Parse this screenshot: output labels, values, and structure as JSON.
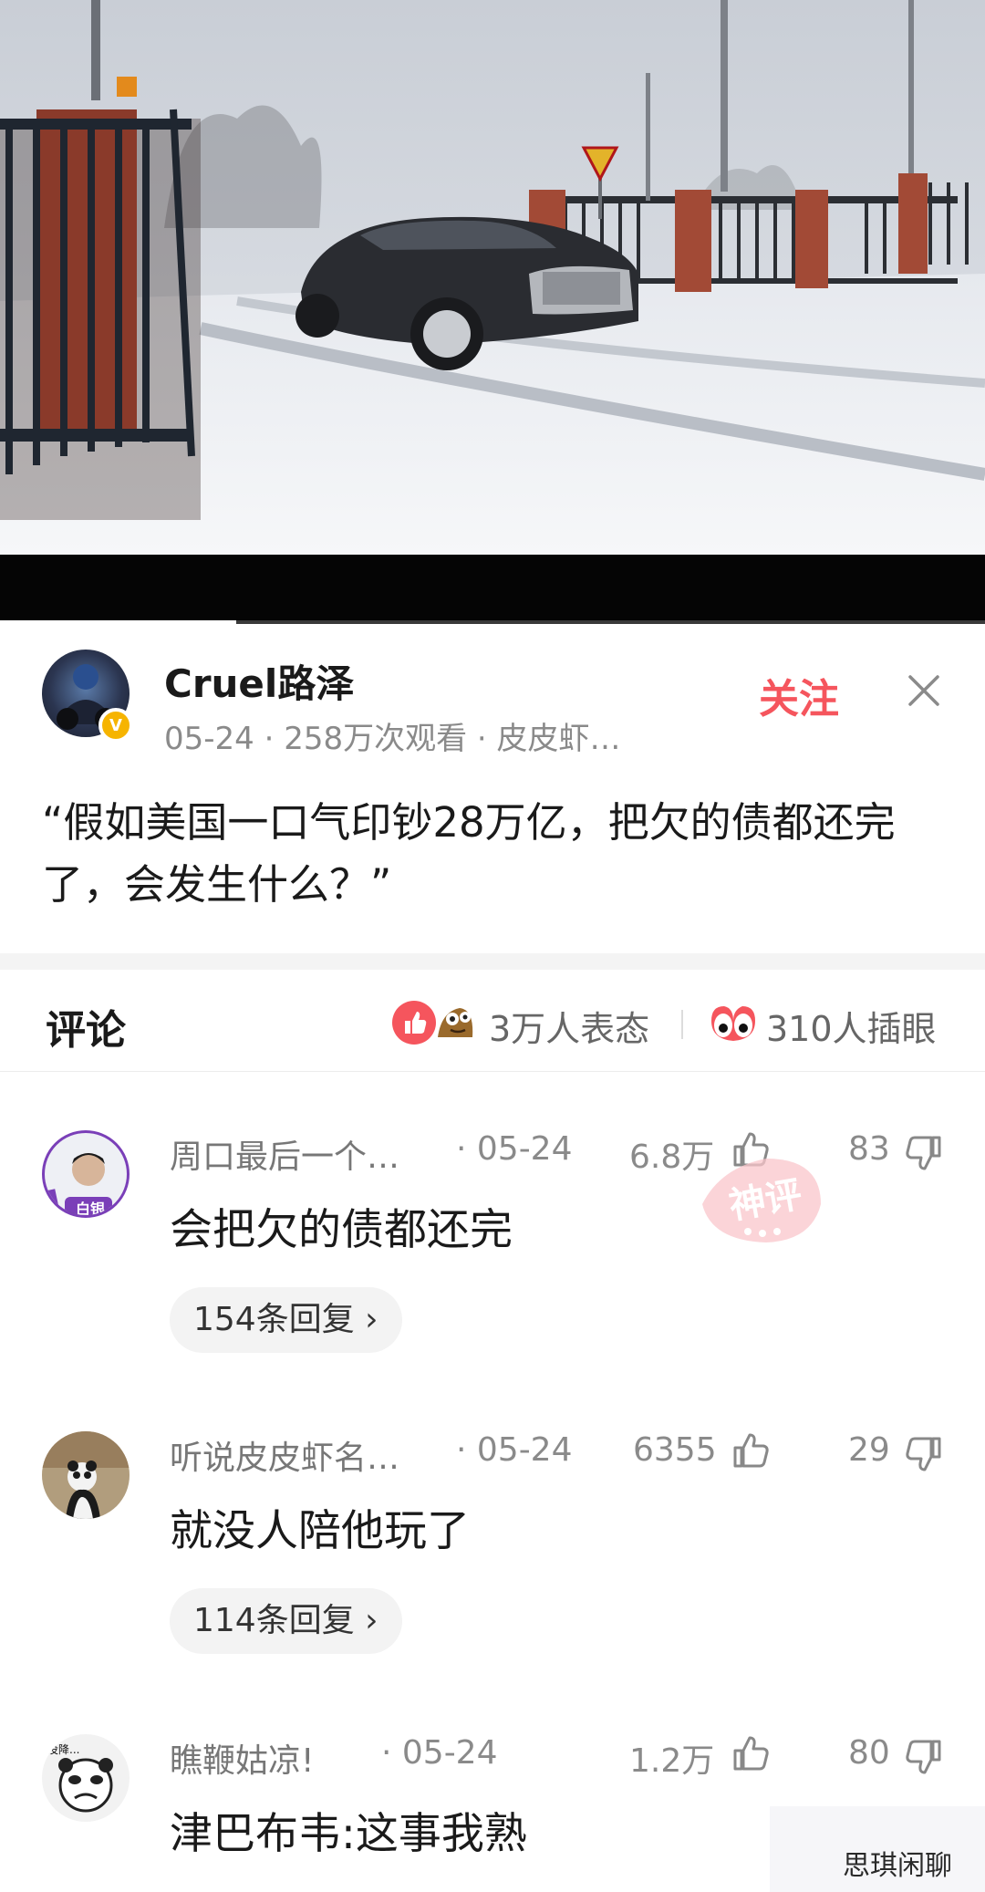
{
  "video": {
    "progress": 0.24
  },
  "author": {
    "name": "Cruel路泽",
    "meta": "05-24 · 258万次观看 · 皮皮虾…",
    "follow_label": "关注",
    "badge": "V"
  },
  "post": {
    "text": "“假如美国一口气印钞28万亿，把欠的债都还完了，会发生什么？”"
  },
  "comments_header": {
    "title": "评论",
    "reactions": "3万人表态",
    "eyes": "310人插眼"
  },
  "comments": [
    {
      "user": "周口最后一个…",
      "date": "· 05-24",
      "likes": "6.8万",
      "dislikes": "83",
      "text": "会把欠的债都还完",
      "replies": "154条回复 ›",
      "avatar_label": "白银"
    },
    {
      "user": "听说皮皮虾名…",
      "date": "· 05-24",
      "likes": "6355",
      "dislikes": "29",
      "text": "就没人陪他玩了",
      "replies": "114条回复 ›"
    },
    {
      "user": "瞧鞭姑凉!",
      "date": "· 05-24",
      "likes": "1.2万",
      "dislikes": "80",
      "text": "津巴布韦:这事我熟",
      "avatar_label": "没降..."
    }
  ],
  "stamp_label": "神评",
  "watermark": "思琪闲聊",
  "colors": {
    "accent": "#f5555d",
    "badge": "#f6b400"
  },
  "icons": [
    "close-icon",
    "thumb-up-icon",
    "thumb-down-icon",
    "eyes-icon",
    "verified-icon"
  ]
}
